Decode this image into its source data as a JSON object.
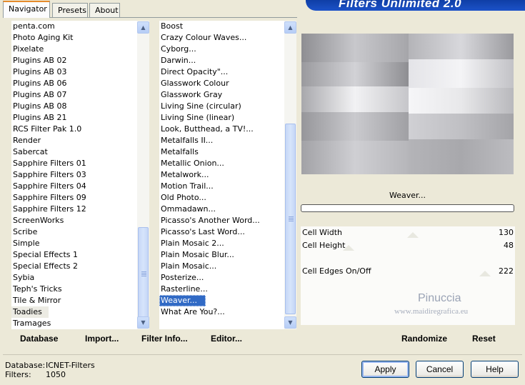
{
  "tabs": [
    "Navigator",
    "Presets",
    "About"
  ],
  "banner_title": "Filters Unlimited 2.0",
  "category_list": {
    "items": [
      "penta.com",
      "Photo Aging Kit",
      "Pixelate",
      "Plugins AB 02",
      "Plugins AB 03",
      "Plugins AB 06",
      "Plugins AB 07",
      "Plugins AB 08",
      "Plugins AB 21",
      "RCS Filter Pak 1.0",
      "Render",
      "Sabercat",
      "Sapphire Filters 01",
      "Sapphire Filters 03",
      "Sapphire Filters 04",
      "Sapphire Filters 09",
      "Sapphire Filters 12",
      "ScreenWorks",
      "Scribe",
      "Simple",
      "Special Effects 1",
      "Special Effects 2",
      "Sybia",
      "Teph's Tricks",
      "Tile & Mirror",
      "Toadies",
      "Tramages"
    ],
    "selected": "Toadies"
  },
  "filter_list": {
    "items": [
      "Boost",
      "Crazy Colour Waves...",
      "Cyborg...",
      "Darwin...",
      "Direct Opacity\"...",
      "Glasswork Colour",
      "Glasswork Gray",
      "Living Sine (circular)",
      "Living Sine (linear)",
      "Look, Butthead, a TV!...",
      "Metalfalls II...",
      "Metalfalls",
      "Metallic Onion...",
      "Metalwork...",
      "Motion Trail...",
      "Old Photo...",
      "Ommadawn...",
      "Picasso's Another Word...",
      "Picasso's Last Word...",
      "Plain Mosaic 2...",
      "Plain Mosaic Blur...",
      "Plain Mosaic...",
      "Posterize...",
      "Rasterline...",
      "Weaver...",
      "What Are You?..."
    ],
    "selected": "Weaver..."
  },
  "current_filter": "Weaver...",
  "parameters": [
    {
      "label": "Cell Width",
      "value": "130",
      "level": 130
    },
    {
      "label": "Cell Height",
      "value": "48",
      "level": 48
    },
    {
      "label": "Cell Edges On/Off",
      "value": "222",
      "level": 222
    }
  ],
  "watermark": {
    "line1": "Pinuccia",
    "line2": "www.maidiregrafica.eu"
  },
  "left_buttons": {
    "database": "Database",
    "import": "Import...",
    "filter_info": "Filter Info...",
    "editor": "Editor..."
  },
  "right_buttons": {
    "randomize": "Randomize",
    "reset": "Reset"
  },
  "status": {
    "database_label": "Database:",
    "database_value": "ICNET-Filters",
    "filters_label": "Filters:",
    "filters_value": "1050"
  },
  "dialog_buttons": {
    "apply": "Apply",
    "cancel": "Cancel",
    "help": "Help"
  },
  "colors": {
    "window_bg": "#ece9d8",
    "selection": "#316ac5",
    "banner": "#0f3ea6"
  }
}
